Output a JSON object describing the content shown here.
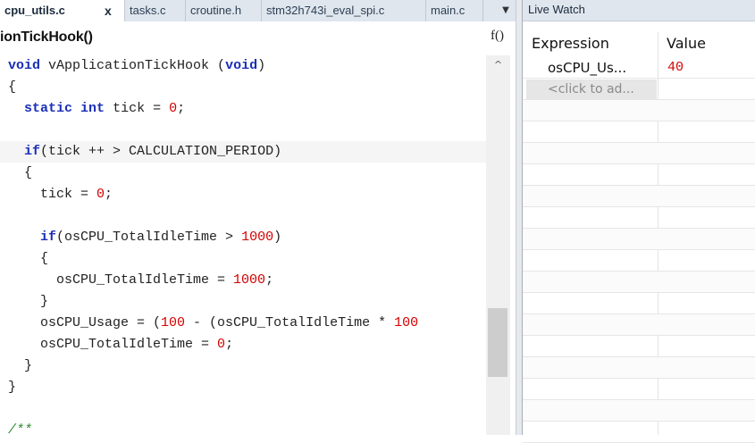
{
  "tabs": [
    {
      "label": "cpu_utils.c",
      "active": true
    },
    {
      "label": "tasks.c",
      "active": false
    },
    {
      "label": "croutine.h",
      "active": false
    },
    {
      "label": "stm32h743i_eval_spi.c",
      "active": false
    },
    {
      "label": "main.c",
      "active": false
    }
  ],
  "tab_close_glyph": "x",
  "tab_dropdown_glyph": "▼",
  "function_bar": {
    "name": "ionTickHook()",
    "icon_glyph": "f()"
  },
  "code_lines": [
    "void vApplicationTickHook (void)",
    "{",
    "  static int tick = 0;",
    "",
    "  if(tick ++ > CALCULATION_PERIOD)",
    "  {",
    "    tick = 0;",
    "",
    "    if(osCPU_TotalIdleTime > 1000)",
    "    {",
    "      osCPU_TotalIdleTime = 1000;",
    "    }",
    "    osCPU_Usage = (100 - (osCPU_TotalIdleTime * 100",
    "    osCPU_TotalIdleTime = 0;",
    "  }",
    "}",
    "",
    "/**"
  ],
  "scroll_up_glyph": "^",
  "live_watch": {
    "title": "Live Watch",
    "columns": {
      "expression": "Expression",
      "value": "Value"
    },
    "rows": [
      {
        "expression": "osCPU_Us...",
        "value": "40"
      }
    ],
    "add_placeholder": "<click to ad..."
  },
  "colors": {
    "keyword": "#1a2fb8",
    "number": "#d40000",
    "tab_bar": "#dfe6ee",
    "current_line": "#f5f5f5"
  }
}
